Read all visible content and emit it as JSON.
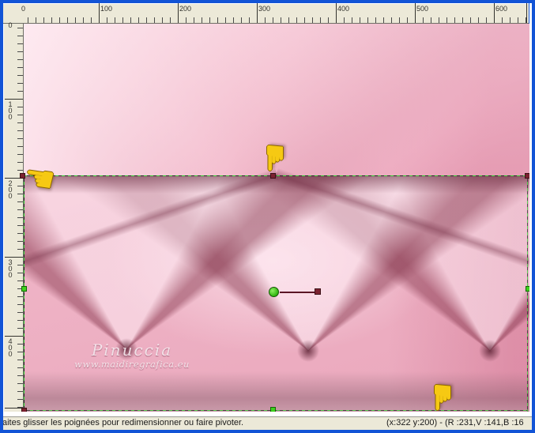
{
  "rulers": {
    "horizontal": {
      "labels": [
        "0",
        "100",
        "200",
        "300",
        "400",
        "500",
        "600"
      ]
    },
    "vertical": {
      "labels": [
        "0",
        "100",
        "200",
        "300",
        "400"
      ]
    }
  },
  "canvas": {
    "watermark": {
      "name": "Pinuccia",
      "url": "www.maidiregrafica.eu"
    }
  },
  "icons": {
    "pointing_hand": "☚"
  },
  "status_bar": {
    "message": "aites glisser les poignées pour redimensionner ou faire pivoter.",
    "position_readout": "(x:322 y:200) - (R :231,V :141,B :16"
  },
  "colors": {
    "frame_blue": "#1254d6",
    "ruler_beige": "#ece9d8",
    "selection_green": "#2fd22f",
    "handle_maroon": "#7b2230",
    "handle_green": "#3ed21e",
    "hand_yellow": "#f6c913",
    "canvas_pink": "#eeb0c3"
  }
}
